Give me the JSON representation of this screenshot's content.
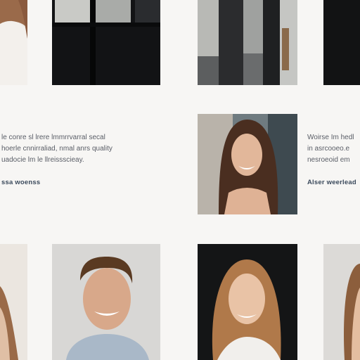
{
  "background": "#f7f6f4",
  "accent": "#3b4a5c",
  "testimonial_left": {
    "lines": [
      "le conre sl lrere lmmrrvarral secal",
      "hoerle cnnirraliad, nmal anrs quality",
      "uadocie lm le llreissscieay."
    ],
    "link_label": "ssa woenss"
  },
  "testimonial_right": {
    "lines": [
      "Woirse Im hedl",
      "in asrcooeo.e",
      "nesroeoid em"
    ],
    "link_label": "Alser weerlead"
  },
  "photos": [
    {
      "name": "photo-woman-cropped-top-left",
      "alt": "woman in white top"
    },
    {
      "name": "photo-dark-doorway",
      "alt": "dark glass doorway"
    },
    {
      "name": "photo-window-frames",
      "alt": "window with dark frames"
    },
    {
      "name": "photo-dark-edge-top-right",
      "alt": "dark panel"
    },
    {
      "name": "photo-woman-brunette-smiling",
      "alt": "smiling brunette woman"
    },
    {
      "name": "photo-woman-cropped-bottom-left",
      "alt": "woman with long hair"
    },
    {
      "name": "photo-man-smiling",
      "alt": "smiling man in denim shirt"
    },
    {
      "name": "photo-woman-blonde-smiling",
      "alt": "smiling blonde woman"
    },
    {
      "name": "photo-woman-cropped-bottom-right",
      "alt": "woman partially visible"
    }
  ]
}
